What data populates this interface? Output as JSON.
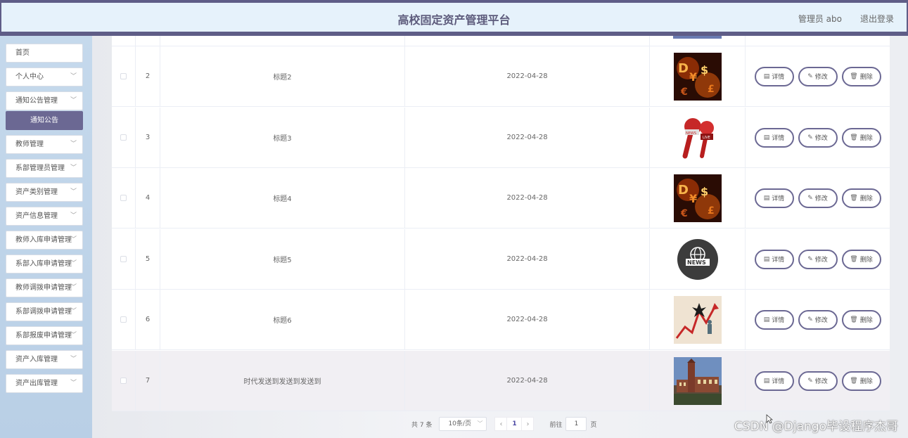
{
  "header": {
    "title": "高校固定资产管理平台",
    "user": "管理员 abo",
    "logout": "退出登录"
  },
  "sidebar": {
    "items": [
      {
        "label": "首页",
        "chevron": false
      },
      {
        "label": "个人中心",
        "chevron": true
      },
      {
        "label": "通知公告管理",
        "chevron": true
      },
      {
        "label": "通知公告",
        "active": true
      },
      {
        "label": "教师管理",
        "chevron": true
      },
      {
        "label": "系部管理员管理",
        "chevron": true
      },
      {
        "label": "资产类别管理",
        "chevron": true
      },
      {
        "label": "资产信息管理",
        "chevron": true
      },
      {
        "label": "教师入库申请管理",
        "chevron": true
      },
      {
        "label": "系部入库申请管理",
        "chevron": true
      },
      {
        "label": "教师调拨申请管理",
        "chevron": true
      },
      {
        "label": "系部调拨申请管理",
        "chevron": true
      },
      {
        "label": "系部报废申请管理",
        "chevron": true
      },
      {
        "label": "资产入库管理",
        "chevron": true
      },
      {
        "label": "资产出库管理",
        "chevron": true
      }
    ]
  },
  "table": {
    "rows": [
      {
        "num": "2",
        "title": "标题2",
        "date": "2022-04-28",
        "image": "money-image"
      },
      {
        "num": "3",
        "title": "标题3",
        "date": "2022-04-28",
        "image": "microphone-image"
      },
      {
        "num": "4",
        "title": "标题4",
        "date": "2022-04-28",
        "image": "money-image"
      },
      {
        "num": "5",
        "title": "标题5",
        "date": "2022-04-28",
        "image": "news-globe-image"
      },
      {
        "num": "6",
        "title": "标题6",
        "date": "2022-04-28",
        "image": "stock-chart-image"
      },
      {
        "num": "7",
        "title": "时代发送到发送到发送到",
        "date": "2022-04-28",
        "image": "building-image"
      }
    ],
    "actions": {
      "detail": "详情",
      "edit": "修改",
      "delete": "删除"
    }
  },
  "pagination": {
    "total": "共 7 条",
    "page_size": "10条/页",
    "current": "1",
    "goto_label": "前往",
    "goto_value": "1",
    "page_unit": "页"
  },
  "watermark": "CSDN @Django毕设程序杰哥",
  "colors": {
    "accent": "#6b6893",
    "header_bg": "#e6f2fb",
    "sidebar_bg": "#c5d9ec"
  }
}
